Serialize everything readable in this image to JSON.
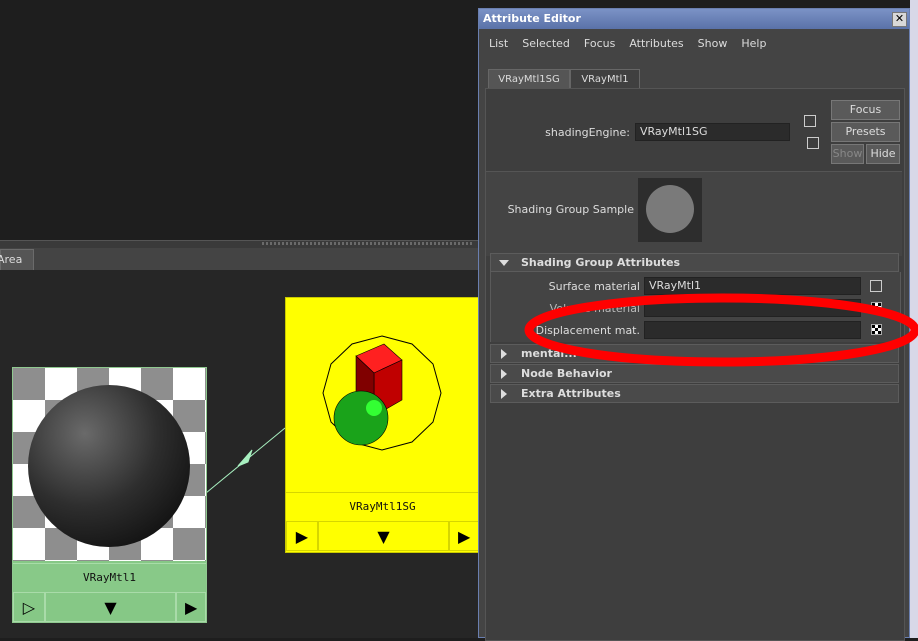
{
  "work_area": {
    "tab_label": "Area"
  },
  "nodes": {
    "material": {
      "name": "VRayMtl1"
    },
    "shading_group": {
      "name": "VRayMtl1SG"
    }
  },
  "attribute_editor": {
    "title": "Attribute Editor",
    "close_glyph": "✕",
    "menu": [
      "List",
      "Selected",
      "Focus",
      "Attributes",
      "Show",
      "Help"
    ],
    "tabs": [
      "VRayMtl1SG",
      "VRayMtl1"
    ],
    "shading_engine": {
      "label": "shadingEngine:",
      "value": "VRayMtl1SG"
    },
    "buttons": {
      "focus": "Focus",
      "presets": "Presets",
      "show": "Show",
      "hide": "Hide"
    },
    "sample": {
      "label": "Shading Group Sample"
    },
    "sections": {
      "shading_group_attributes": "Shading Group Attributes",
      "mental": "mental...",
      "node_behavior": "Node Behavior",
      "extra_attributes": "Extra Attributes"
    },
    "attributes": {
      "surface_material": {
        "label": "Surface material",
        "value": "VRayMtl1"
      },
      "volume_material": {
        "label": "Volume material",
        "value": ""
      },
      "displacement_material": {
        "label": "Displacement mat.",
        "value": ""
      }
    }
  },
  "annotation": {
    "color": "#ff0000"
  }
}
